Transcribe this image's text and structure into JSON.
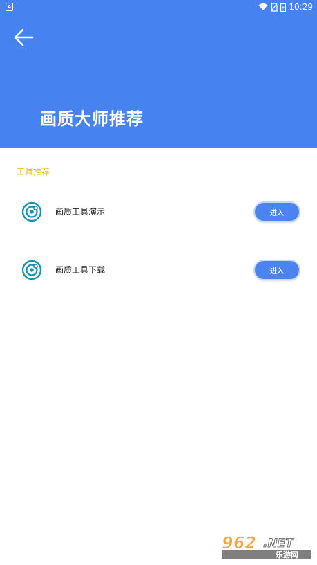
{
  "status_bar": {
    "time": "10:29",
    "notification_badge": "A",
    "icons": [
      "wifi-icon",
      "no-sim-icon",
      "battery-icon"
    ]
  },
  "header": {
    "title": "画质大师推荐",
    "background_color": "#4683f0",
    "back_icon": "arrow-left-icon"
  },
  "section": {
    "title": "工具推荐",
    "title_color": "#e9b619"
  },
  "tools": [
    {
      "label": "画质工具演示",
      "button_label": "进入",
      "icon": "lens-icon"
    },
    {
      "label": "画质工具下载",
      "button_label": "进入",
      "icon": "lens-icon"
    }
  ],
  "watermark": {
    "brand": "962",
    "suffix": ".NET",
    "tagline": "乐游网"
  },
  "colors": {
    "accent": "#4b84ee",
    "icon": "#1b8fb0"
  }
}
